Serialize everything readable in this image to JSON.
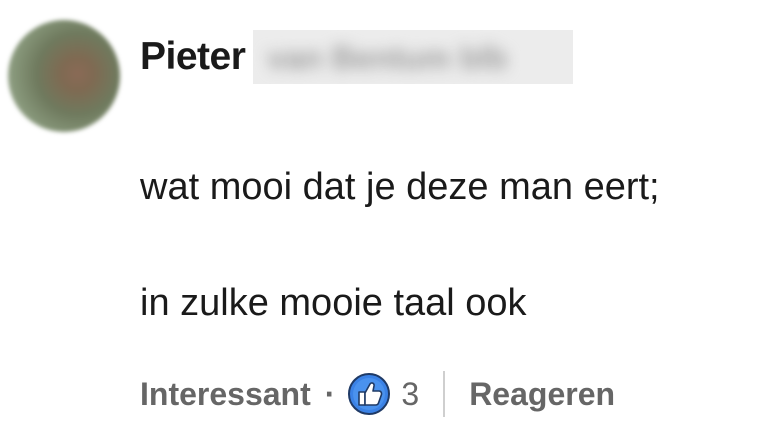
{
  "comment": {
    "author_first": "Pieter",
    "author_last_redacted": "van Bentum blb",
    "text_line1": "wat mooi dat je deze man eert;",
    "text_line2": "in zulke mooie taal ook"
  },
  "actions": {
    "react_label": "Interessant",
    "separator": "·",
    "reaction_icon": "thumbs-up-icon",
    "reaction_count": "3",
    "reply_label": "Reageren"
  },
  "colors": {
    "text_primary": "#1a1a1a",
    "text_secondary": "#666666",
    "like_blue": "#3b82e6"
  }
}
